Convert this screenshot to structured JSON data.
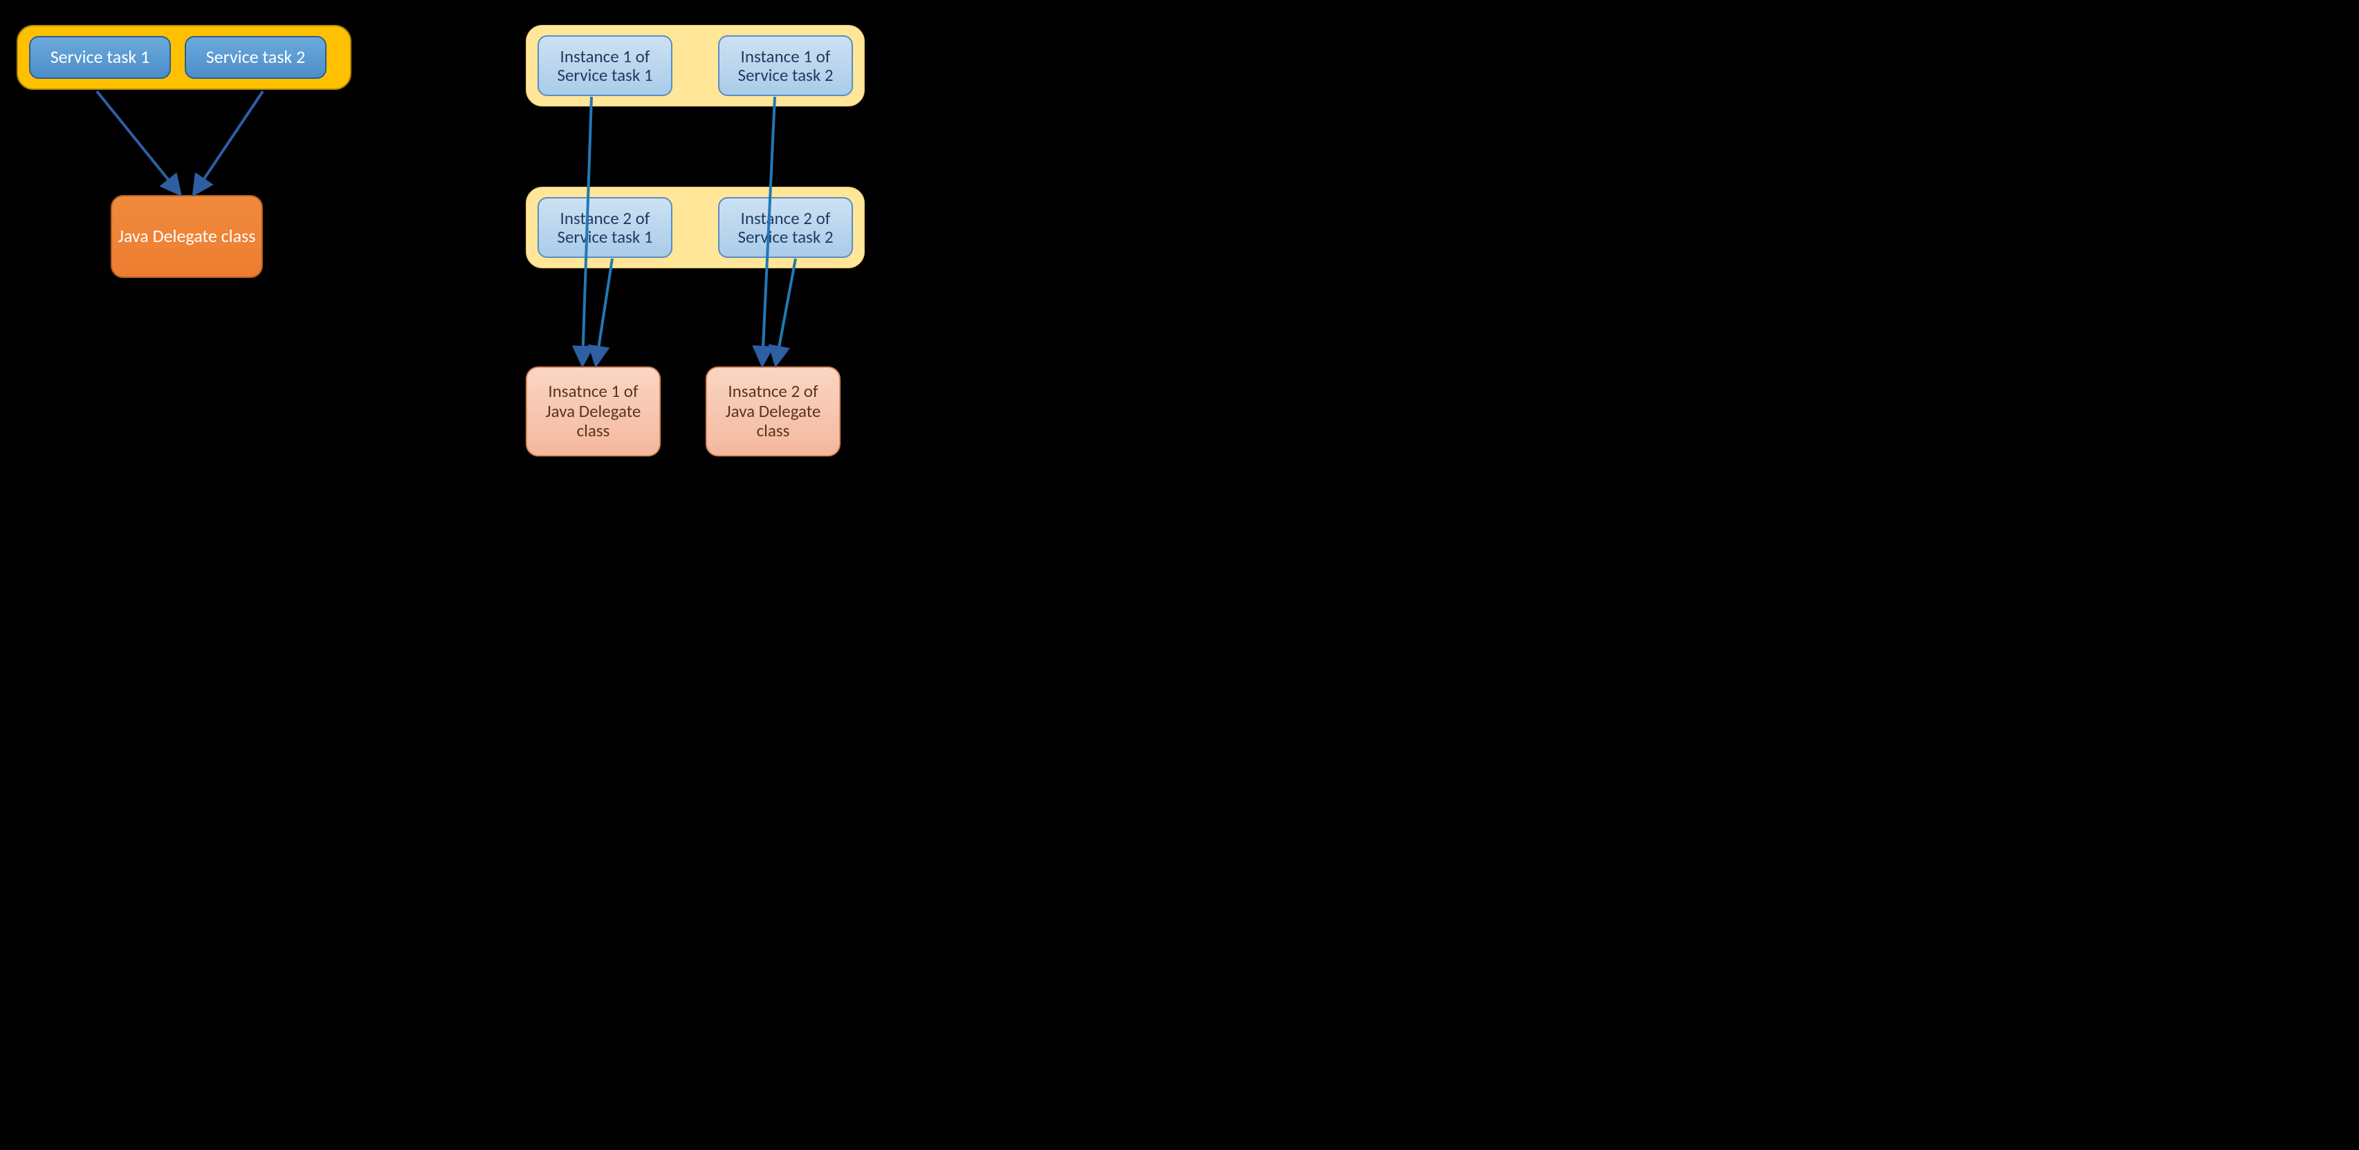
{
  "left": {
    "task1": "Service task 1",
    "task2": "Service task 2",
    "delegate": "Java Delegate class"
  },
  "right": {
    "row1": {
      "task1_line1": "Instance 1 of",
      "task1_line2": "Service task 1",
      "task2_line1": "Instance 1 of",
      "task2_line2": "Service task 2"
    },
    "row2": {
      "task1_line1": "Instance 2 of",
      "task1_line2": "Service task 1",
      "task2_line1": "Instance 2 of",
      "task2_line2": "Service task 2"
    },
    "delegate1_line1": "Insatnce 1 of",
    "delegate1_line2": "Java Delegate",
    "delegate1_line3": "class",
    "delegate2_line1": "Insatnce 2 of",
    "delegate2_line2": "Java Delegate",
    "delegate2_line3": "class"
  }
}
